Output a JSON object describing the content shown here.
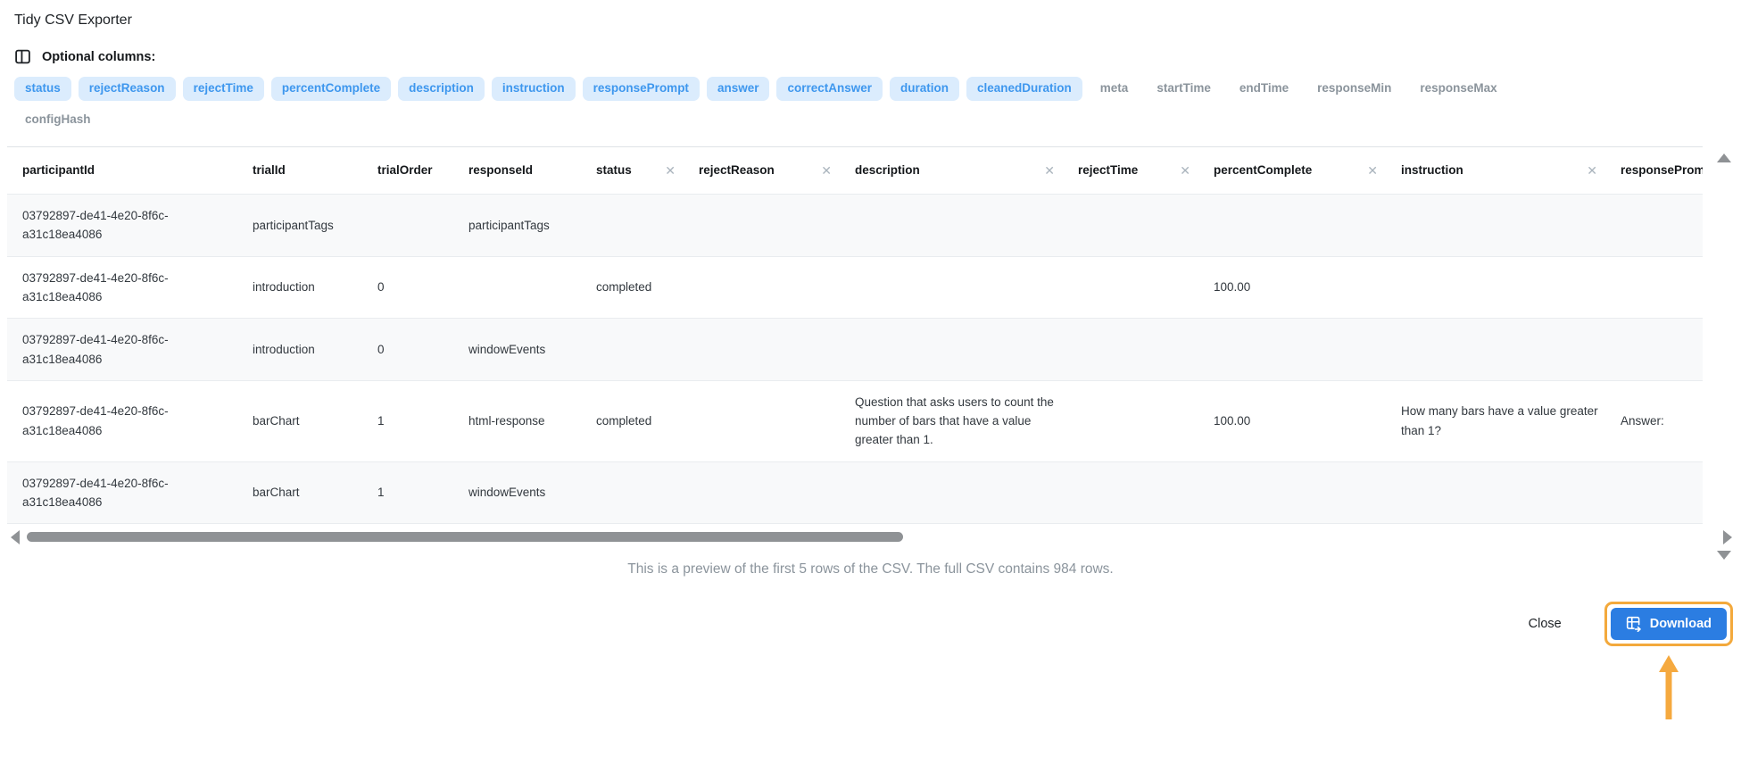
{
  "title": "Tidy CSV Exporter",
  "optional_columns": {
    "label": "Optional columns:",
    "active": [
      "status",
      "rejectReason",
      "rejectTime",
      "percentComplete",
      "description",
      "instruction",
      "responsePrompt",
      "answer",
      "correctAnswer",
      "duration",
      "cleanedDuration"
    ],
    "inactive": [
      "meta",
      "startTime",
      "endTime",
      "responseMin",
      "responseMax",
      "configHash"
    ]
  },
  "table": {
    "columns": [
      {
        "label": "participantId",
        "removable": false
      },
      {
        "label": "trialId",
        "removable": false
      },
      {
        "label": "trialOrder",
        "removable": false
      },
      {
        "label": "responseId",
        "removable": false
      },
      {
        "label": "status",
        "removable": true
      },
      {
        "label": "rejectReason",
        "removable": true
      },
      {
        "label": "description",
        "removable": true
      },
      {
        "label": "rejectTime",
        "removable": true
      },
      {
        "label": "percentComplete",
        "removable": true
      },
      {
        "label": "instruction",
        "removable": true
      },
      {
        "label": "responsePrompt",
        "removable": true
      }
    ],
    "rows": [
      [
        "03792897-de41-4e20-8f6c-a31c18ea4086",
        "participantTags",
        "",
        "participantTags",
        "",
        "",
        "",
        "",
        "",
        "",
        ""
      ],
      [
        "03792897-de41-4e20-8f6c-a31c18ea4086",
        "introduction",
        "0",
        "",
        "completed",
        "",
        "",
        "",
        "100.00",
        "",
        ""
      ],
      [
        "03792897-de41-4e20-8f6c-a31c18ea4086",
        "introduction",
        "0",
        "windowEvents",
        "",
        "",
        "",
        "",
        "",
        "",
        ""
      ],
      [
        "03792897-de41-4e20-8f6c-a31c18ea4086",
        "barChart",
        "1",
        "html-response",
        "completed",
        "",
        "Question that asks users to count the number of bars that have a value greater than 1.",
        "",
        "100.00",
        "How many bars have a value greater than 1?",
        "Answer:"
      ],
      [
        "03792897-de41-4e20-8f6c-a31c18ea4086",
        "barChart",
        "1",
        "windowEvents",
        "",
        "",
        "",
        "",
        "",
        "",
        ""
      ]
    ]
  },
  "preview_note": "This is a preview of the first 5 rows of the CSV. The full CSV contains 984 rows.",
  "footer": {
    "close_label": "Close",
    "download_label": "Download"
  },
  "colors": {
    "accent": "#2b7de2",
    "pill_bg": "#dbecfd",
    "pill_text": "#3e97ee",
    "muted2": "#8b949c",
    "highlight": "#f3a93c"
  }
}
